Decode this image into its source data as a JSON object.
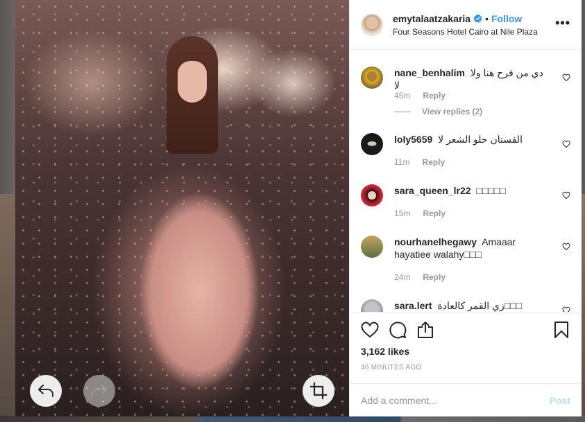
{
  "header": {
    "username": "emytalaatzakaria",
    "separator": "•",
    "follow_label": "Follow",
    "location": "Four Seasons Hotel Cairo at Nile Plaza",
    "more_label": "•••"
  },
  "comments": [
    {
      "username": "nane_benhalim",
      "text": "دي من فرح هنا ولا لا",
      "time": "45m",
      "reply_label": "Reply",
      "view_replies": "View replies (2)"
    },
    {
      "username": "loly5659",
      "text": "الفستان حلو الشعر لا",
      "time": "11m",
      "reply_label": "Reply"
    },
    {
      "username": "sara_queen_lr22",
      "text": "□□□□□",
      "time": "15m",
      "reply_label": "Reply"
    },
    {
      "username": "nourhanelhegawy",
      "text": "Amaaar hayatiee walahy□□□",
      "time": "24m",
      "reply_label": "Reply"
    },
    {
      "username": "sara.lert",
      "text": "زي القمر كالعادة□□□",
      "time": "",
      "reply_label": ""
    }
  ],
  "actions": {
    "likes": "3,162 likes",
    "timestamp": "46 MINUTES AGO"
  },
  "add_comment": {
    "placeholder": "Add a comment...",
    "post_label": "Post"
  },
  "icons": [
    "back-arrow-icon",
    "forward-arrow-icon",
    "crop-icon",
    "heart-icon",
    "comment-icon",
    "share-icon",
    "bookmark-icon",
    "verified-badge-icon",
    "small-heart-icon"
  ],
  "colors": {
    "accent": "#3897f0",
    "post_disabled": "#b2dffc",
    "muted": "#999999"
  }
}
